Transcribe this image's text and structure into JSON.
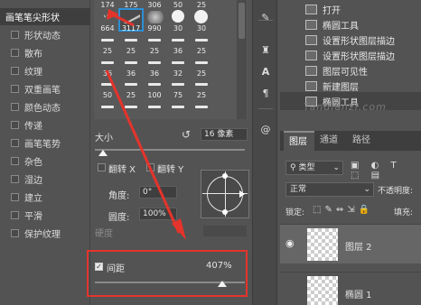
{
  "brush_options": [
    {
      "label": "画笔笔尖形状",
      "header": true
    },
    {
      "label": "形状动态"
    },
    {
      "label": "散布"
    },
    {
      "label": "纹理"
    },
    {
      "label": "双重画笔"
    },
    {
      "label": "颜色动态"
    },
    {
      "label": "传递"
    },
    {
      "label": "画笔笔势"
    },
    {
      "label": "杂色"
    },
    {
      "label": "湿边"
    },
    {
      "label": "建立"
    },
    {
      "label": "平滑"
    },
    {
      "label": "保护纹理"
    }
  ],
  "brush_grid": {
    "row1": [
      "174",
      "175",
      "306",
      "50",
      "25"
    ],
    "row2": [
      "664",
      "3117",
      "990",
      "30",
      "30"
    ],
    "row3": [
      "25",
      "25",
      "25",
      "36",
      "25"
    ],
    "row4": [
      "36",
      "36",
      "36",
      "32",
      "25"
    ],
    "row5": [
      "50",
      "25",
      "100",
      "75",
      "25"
    ]
  },
  "settings": {
    "size_label": "大小",
    "size_value": "16 像素",
    "flip_x": "翻转 X",
    "flip_y": "翻转 Y",
    "angle_label": "角度:",
    "angle_value": "0°",
    "roundness_label": "圆度:",
    "roundness_value": "100%",
    "hardness_label": "硬度",
    "spacing_label": "间距",
    "spacing_value": "407%"
  },
  "history": {
    "items": [
      "打开",
      "椭圆工具",
      "设置形状图层描边",
      "设置形状图层描边",
      "图层可见性",
      "新建图层",
      "椭圆工具"
    ]
  },
  "watermark": "Tandianzi.com",
  "layers": {
    "tabs": [
      "图层",
      "通道",
      "路径"
    ],
    "filter_label": "类型",
    "blend_mode": "正常",
    "opacity_label": "不透明度:",
    "lock_label": "锁定:",
    "fill_label": "填充:",
    "layer_names": [
      "图层 2",
      "椭圆 1"
    ]
  },
  "colors": {
    "panel_bg": "#535353",
    "highlight": "#e4342c",
    "selection": "#2d8fd5"
  }
}
